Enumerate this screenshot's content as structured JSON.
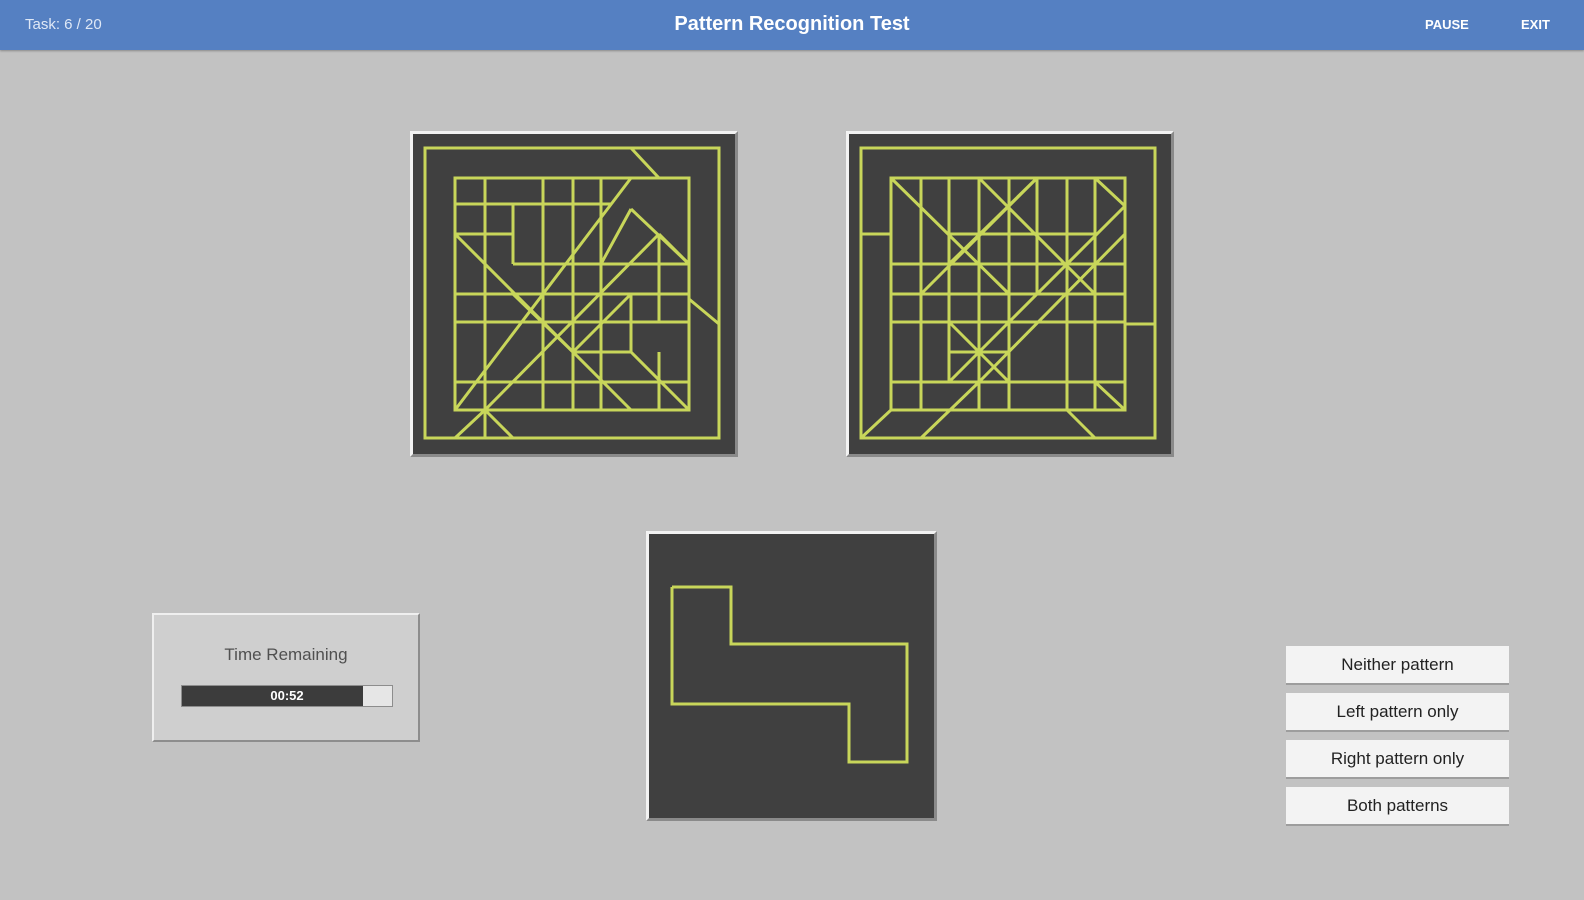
{
  "header": {
    "task_progress": "Task: 6 / 20",
    "title": "Pattern Recognition Test",
    "pause_label": "PAUSE",
    "exit_label": "EXIT"
  },
  "timer": {
    "label": "Time Remaining",
    "value": "00:52",
    "fraction_remaining": 0.86
  },
  "answers": [
    {
      "label": "Neither pattern"
    },
    {
      "label": "Left pattern only"
    },
    {
      "label": "Right pattern only"
    },
    {
      "label": "Both patterns"
    }
  ],
  "colors": {
    "header_bar": "#5580c2",
    "background": "#c2c2c2",
    "panel_bg": "#404040",
    "line_color": "#c8d65a"
  }
}
